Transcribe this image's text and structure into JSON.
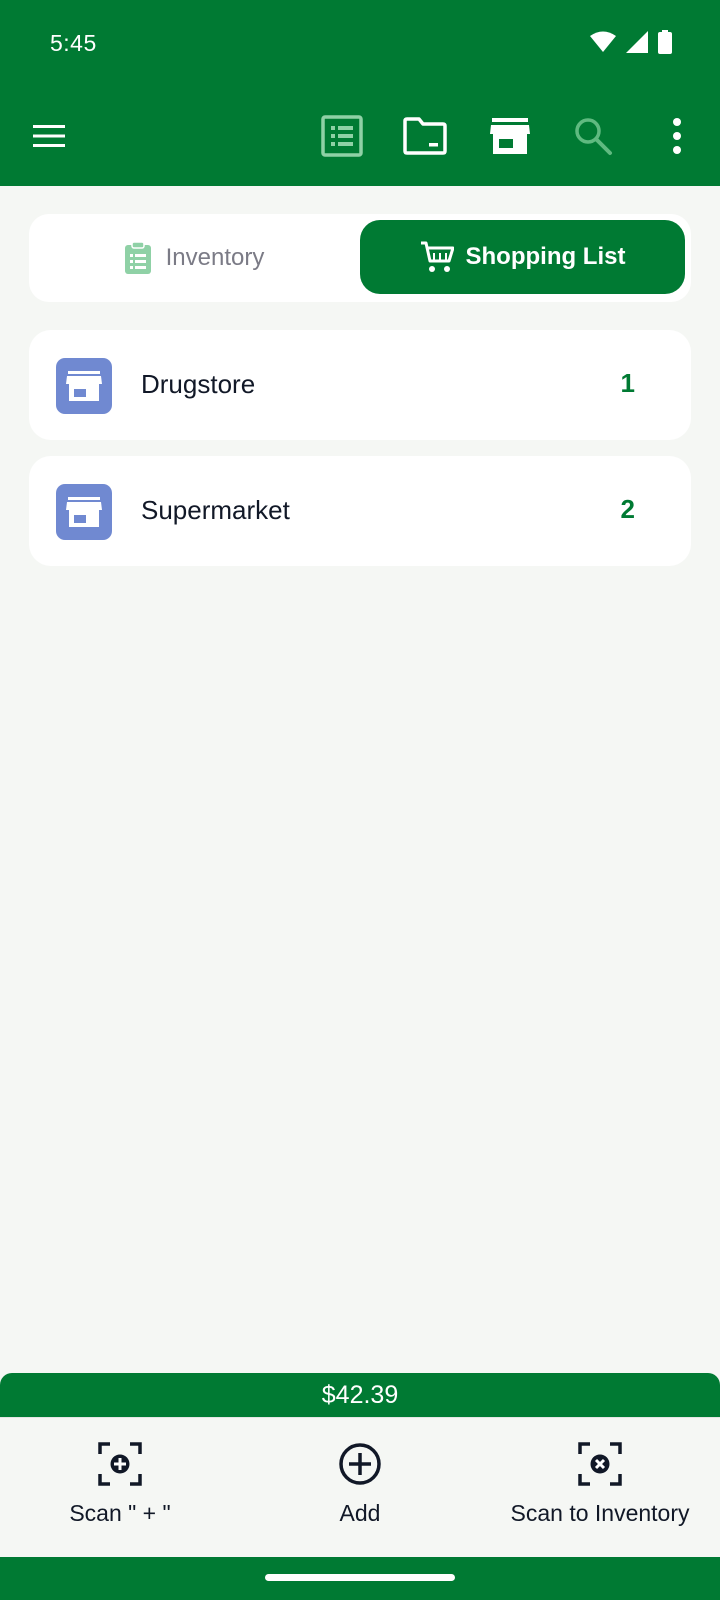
{
  "status_bar": {
    "time": "5:45"
  },
  "app_bar": {
    "icons": [
      "menu-icon",
      "list-icon",
      "folder-icon",
      "store-icon",
      "search-icon",
      "more-vert-icon"
    ]
  },
  "tabs": {
    "inventory_label": "Inventory",
    "shopping_label": "Shopping List",
    "active": "Shopping List"
  },
  "stores": [
    {
      "name": "Drugstore",
      "count": "1"
    },
    {
      "name": "Supermarket",
      "count": "2"
    }
  ],
  "total": "$42.39",
  "actions": {
    "scan_plus": "Scan \" + \"",
    "add": "Add",
    "scan_to_inventory": "Scan to Inventory"
  },
  "colors": {
    "brand_green": "#007a33",
    "store_icon_bg": "#7089d1",
    "background": "#f5f7f4"
  }
}
